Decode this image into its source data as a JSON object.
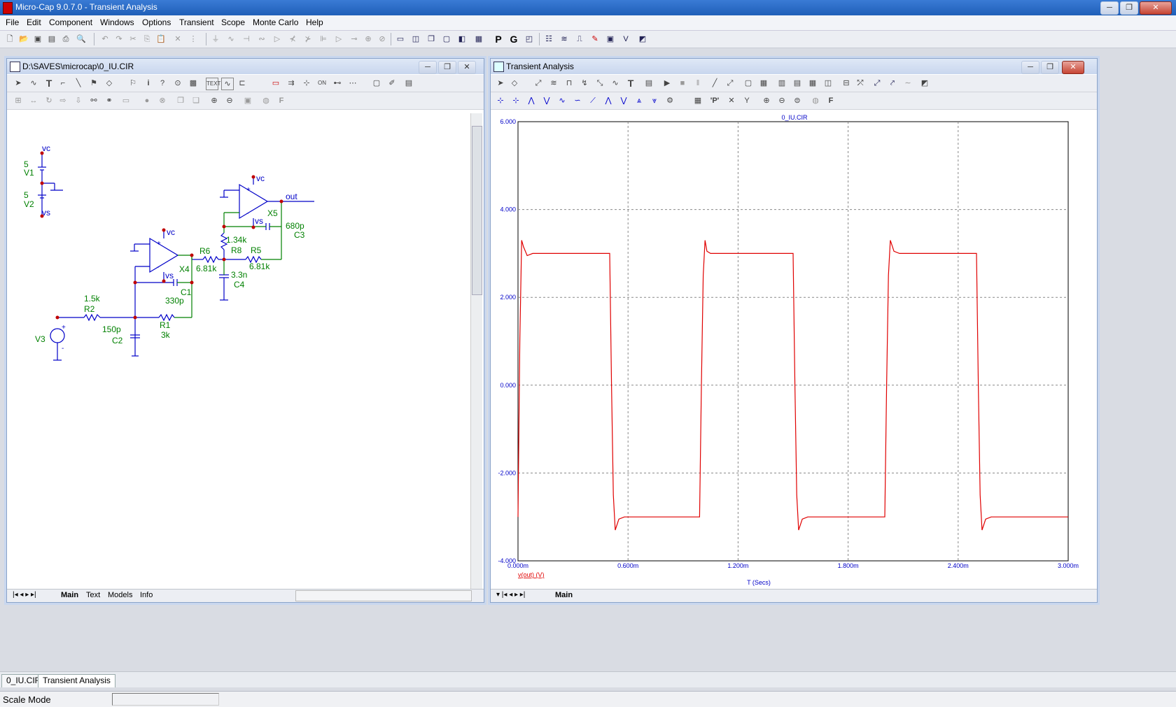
{
  "app": {
    "title": "Micro-Cap 9.0.7.0 - Transient Analysis"
  },
  "menu": [
    "File",
    "Edit",
    "Component",
    "Windows",
    "Options",
    "Transient",
    "Scope",
    "Monte Carlo",
    "Help"
  ],
  "schematic": {
    "title": "D:\\SAVES\\microcap\\0_IU.CIR",
    "tabs": [
      "Main",
      "Text",
      "Models",
      "Info"
    ],
    "labels": {
      "vc": "vc",
      "vs": "vs",
      "five": "5",
      "v1": "V1",
      "v2": "V2",
      "v3": "V3",
      "x4": "X4",
      "x5": "X5",
      "out": "out",
      "r1": "R1",
      "r1v": "3k",
      "r2": "R2",
      "r2v": "1.5k",
      "r5": "R5",
      "r5v": "6.81k",
      "r6": "R6",
      "r6v": "6.81k",
      "r8": "R8",
      "r8v": "1.34k",
      "c1": "C1",
      "c1v": "330p",
      "c2": "C2",
      "c2v": "150p",
      "c3": "C3",
      "c3v": "680p",
      "c4": "C4",
      "c4v": "3.3n",
      "plus": "+",
      "minus": "-"
    }
  },
  "analysis": {
    "title": "Transient Analysis",
    "tabs": [
      "Main"
    ],
    "chart_data": {
      "type": "line",
      "title": "0_IU.CIR",
      "xlabel": "T (Secs)",
      "ylabel": "",
      "xlim": [
        0,
        3.0
      ],
      "ylim": [
        -4.0,
        6.0
      ],
      "x_ticks": [
        "0.000m",
        "0.600m",
        "1.200m",
        "1.800m",
        "2.400m",
        "3.000m"
      ],
      "y_ticks": [
        "6.000",
        "4.000",
        "2.000",
        "0.000",
        "-2.000",
        "-4.000"
      ],
      "grid": true,
      "color": "#e00000",
      "series": [
        {
          "name": "v(out) (V)",
          "x_unit": "ms",
          "x": [
            0.0,
            0.01,
            0.02,
            0.03,
            0.05,
            0.08,
            0.5,
            0.51,
            0.52,
            0.53,
            0.55,
            0.58,
            0.99,
            1.0,
            1.01,
            1.02,
            1.03,
            1.05,
            1.08,
            1.5,
            1.51,
            1.52,
            1.53,
            1.55,
            1.58,
            2.0,
            2.01,
            2.02,
            2.03,
            2.05,
            2.08,
            2.5,
            2.51,
            2.52,
            2.53,
            2.55,
            2.58,
            3.0
          ],
          "y": [
            -3.0,
            1.0,
            3.3,
            3.15,
            2.95,
            3.0,
            3.0,
            0.0,
            -2.5,
            -3.3,
            -3.05,
            -3.0,
            -3.0,
            0.0,
            2.5,
            3.3,
            3.05,
            3.0,
            3.0,
            3.0,
            0.0,
            -2.5,
            -3.3,
            -3.05,
            -3.0,
            -3.0,
            0.0,
            2.5,
            3.3,
            3.05,
            3.0,
            3.0,
            0.0,
            -2.5,
            -3.3,
            -3.05,
            -3.0,
            -3.0
          ]
        }
      ]
    }
  },
  "doc_tabs": [
    "0_IU.CIR",
    "Transient Analysis"
  ],
  "status": {
    "text": "Scale Mode"
  }
}
